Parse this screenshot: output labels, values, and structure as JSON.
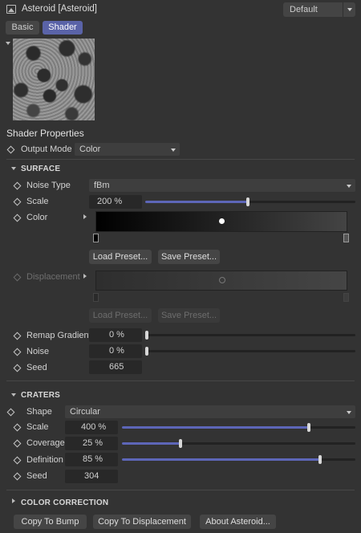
{
  "header": {
    "title": "Asteroid [Asteroid]",
    "preset": "Default"
  },
  "tabs": [
    {
      "label": "Basic",
      "active": false
    },
    {
      "label": "Shader",
      "active": true
    }
  ],
  "shader_properties": {
    "title": "Shader Properties",
    "output_mode": {
      "label": "Output Mode",
      "value": "Color"
    }
  },
  "surface": {
    "title": "SURFACE",
    "noise_type": {
      "label": "Noise Type",
      "value": "fBm"
    },
    "scale": {
      "label": "Scale",
      "value": "200 %",
      "fraction": 0.49
    },
    "color": {
      "label": "Color"
    },
    "load_preset": "Load Preset...",
    "save_preset": "Save Preset...",
    "displacement": {
      "label": "Displacement"
    },
    "load_preset_disabled": "Load Preset...",
    "save_preset_disabled": "Save Preset...",
    "remap_gradient": {
      "label": "Remap Gradient",
      "value": "0 %",
      "fraction": 0
    },
    "noise": {
      "label": "Noise",
      "value": "0 %",
      "fraction": 0
    },
    "seed": {
      "label": "Seed",
      "value": "665"
    }
  },
  "craters": {
    "title": "CRATERS",
    "shape": {
      "label": "Shape",
      "value": "Circular"
    },
    "scale": {
      "label": "Scale",
      "value": "400 %",
      "fraction": 0.8
    },
    "coverage": {
      "label": "Coverage",
      "value": "25 %",
      "fraction": 0.25
    },
    "definition": {
      "label": "Definition",
      "value": "85 %",
      "fraction": 0.85
    },
    "seed": {
      "label": "Seed",
      "value": "304"
    }
  },
  "color_correction": {
    "title": "COLOR CORRECTION"
  },
  "footer": {
    "copy_to_bump": "Copy To Bump",
    "copy_to_displacement": "Copy To Displacement",
    "about": "About Asteroid..."
  },
  "colors": {
    "accent": "#5a63a8",
    "slider_fill": "#5d66b8",
    "background": "#333333"
  }
}
